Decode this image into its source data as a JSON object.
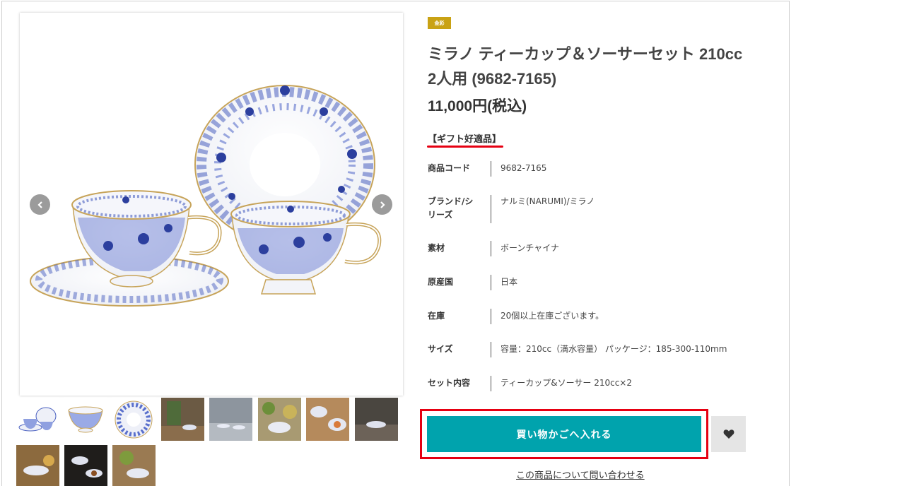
{
  "product": {
    "badge": "金彩",
    "title_line1": "ミラノ ティーカップ＆ソーサーセット 210cc",
    "title_line2": "2人用 (9682-7165)",
    "price": "11,000円(税込)",
    "gift_label": "【ギフト好適品】"
  },
  "specs": [
    {
      "label": "商品コード",
      "value": "9682-7165"
    },
    {
      "label": "ブランド/シリーズ",
      "value": "ナルミ(NARUMI)/ミラノ"
    },
    {
      "label": "素材",
      "value": "ボーンチャイナ"
    },
    {
      "label": "原産国",
      "value": "日本"
    },
    {
      "label": "在庫",
      "value": "20個以上在庫ございます。"
    },
    {
      "label": "サイズ",
      "value": "容量：210cc（満水容量） パッケージ：185-300-110mm"
    },
    {
      "label": "セット内容",
      "value": "ティーカップ&ソーサー 210cc×2"
    }
  ],
  "actions": {
    "cart_label": "買い物かごへ入れる",
    "inquiry_label": "この商品について問い合わせる"
  },
  "colors": {
    "accent": "#00a3ad",
    "highlight": "#e60012",
    "badge": "#c9a214",
    "pattern_blue": "#3c55b5"
  },
  "icons": {
    "prev": "chevron-left-icon",
    "next": "chevron-right-icon",
    "favorite": "heart-icon"
  }
}
